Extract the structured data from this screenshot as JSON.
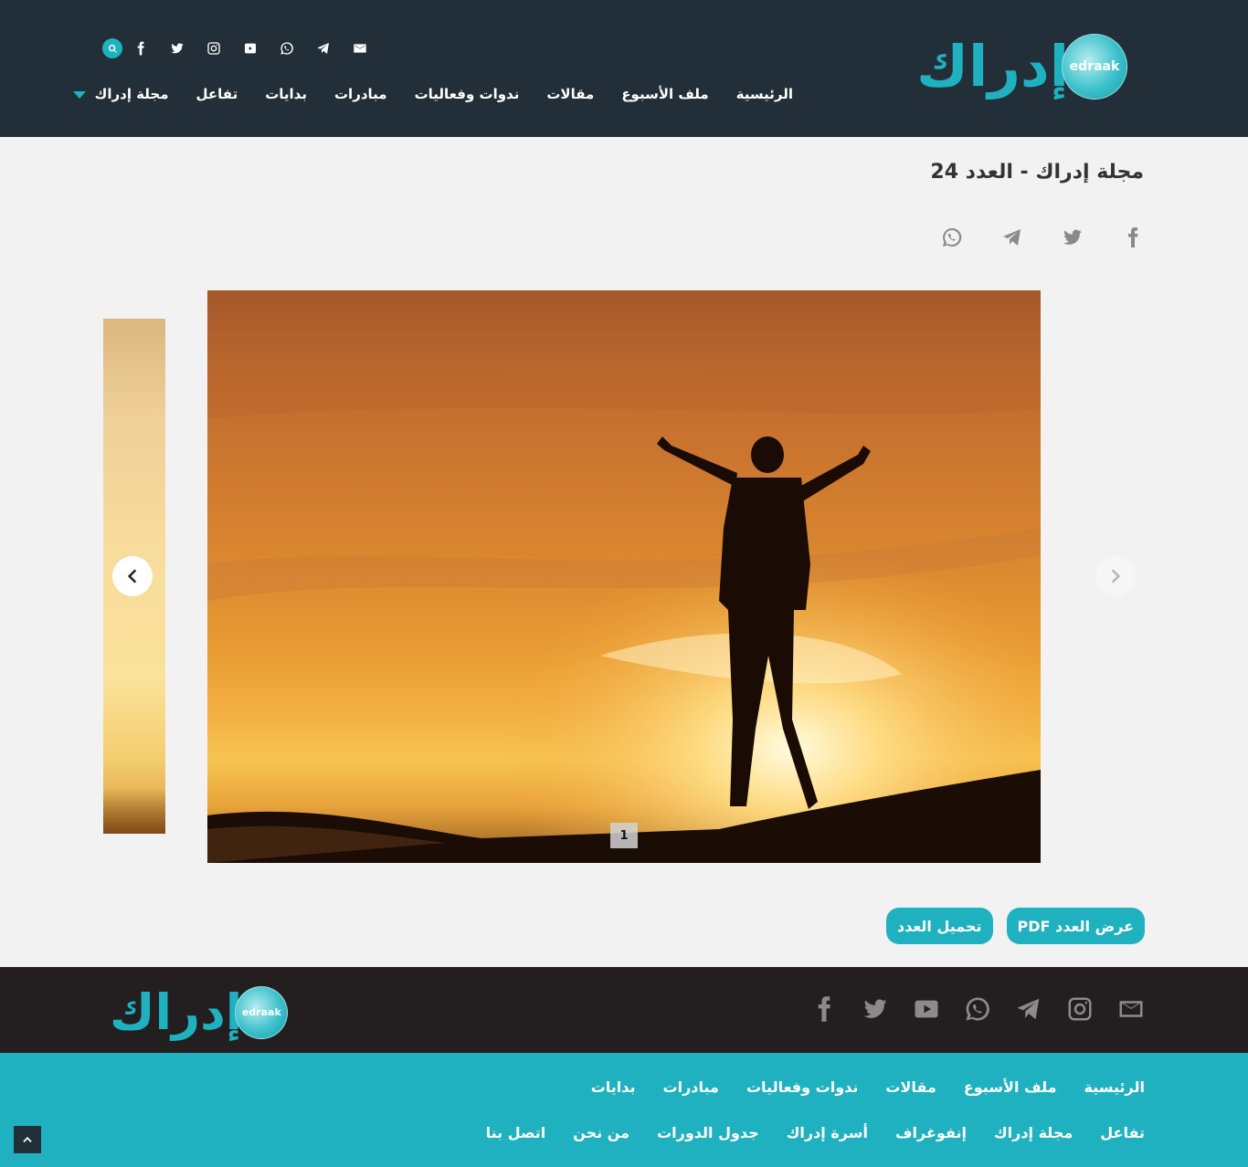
{
  "site": {
    "logo_ar": "إدراك",
    "logo_en": "edraak"
  },
  "header": {
    "social_icons": [
      "search-icon",
      "facebook-icon",
      "twitter-icon",
      "instagram-icon",
      "youtube-icon",
      "whatsapp-icon",
      "telegram-icon",
      "email-icon"
    ],
    "nav": [
      {
        "label": "الرئيسية"
      },
      {
        "label": "ملف الأسبوع"
      },
      {
        "label": "مقالات"
      },
      {
        "label": "ندوات وفعاليات"
      },
      {
        "label": "مبادرات"
      },
      {
        "label": "بدايات"
      },
      {
        "label": "تفاعل"
      },
      {
        "label": "مجلة إدراك"
      }
    ]
  },
  "main": {
    "title": "مجلة إدراك - العدد 24",
    "share_icons": [
      "facebook-icon",
      "twitter-icon",
      "telegram-icon",
      "whatsapp-icon"
    ],
    "slider": {
      "page_number": "1"
    },
    "buttons": {
      "view_pdf": "عرض العدد PDF",
      "download": "تحميل العدد"
    }
  },
  "footer": {
    "social_icons": [
      "email-icon",
      "instagram-icon",
      "telegram-icon",
      "whatsapp-icon",
      "youtube-icon",
      "twitter-icon",
      "facebook-icon"
    ],
    "links_row1": [
      "الرئيسية",
      "ملف الأسبوع",
      "مقالات",
      "ندوات وفعاليات",
      "مبادرات",
      "بدايات"
    ],
    "links_row2": [
      "تفاعل",
      "مجلة إدراك",
      "إنفوغراف",
      "أسرة إدراك",
      "جدول الدورات",
      "من نحن",
      "اتصل بنا"
    ]
  },
  "colors": {
    "header_bg": "#222f38",
    "accent": "#1fb1bf",
    "footer_dark": "#231f20",
    "page_bg": "#f2f2f2"
  }
}
